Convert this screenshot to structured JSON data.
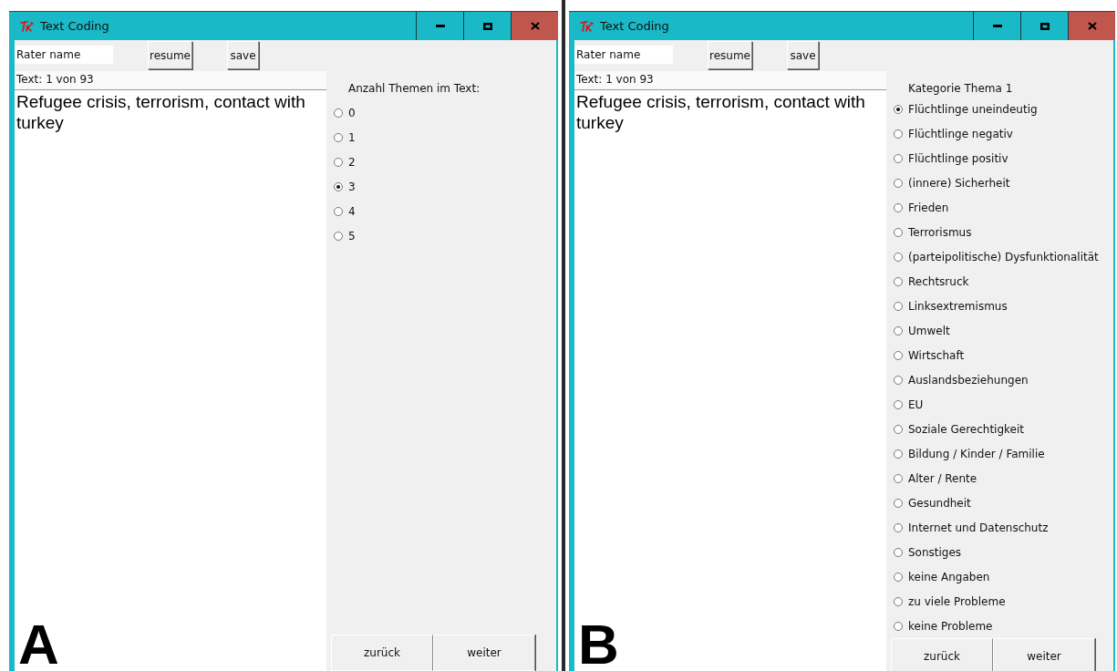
{
  "windows": [
    {
      "panel_label": "A",
      "title": "Text Coding",
      "rater_name": {
        "value": "Rater name"
      },
      "buttons": [
        "resume",
        "save"
      ],
      "text_counter": "Text: 1 von 93",
      "text_content": "Refugee crisis, terrorism, contact with turkey",
      "question": {
        "title": "Anzahl Themen im Text:",
        "options": [
          {
            "label": "0",
            "selected": false
          },
          {
            "label": "1",
            "selected": false
          },
          {
            "label": "2",
            "selected": false
          },
          {
            "label": "3",
            "selected": true
          },
          {
            "label": "4",
            "selected": false
          },
          {
            "label": "5",
            "selected": false
          }
        ]
      },
      "nav_buttons": [
        "zurück",
        "weiter"
      ]
    },
    {
      "panel_label": "B",
      "title": "Text Coding",
      "rater_name": {
        "value": "Rater name"
      },
      "buttons": [
        "resume",
        "save"
      ],
      "text_counter": "Text: 1 von 93",
      "text_content": "Refugee crisis, terrorism, contact with turkey",
      "question": {
        "title": "Kategorie Thema 1",
        "options": [
          {
            "label": "Flüchtlinge uneindeutig",
            "selected": true
          },
          {
            "label": "Flüchtlinge negativ",
            "selected": false
          },
          {
            "label": "Flüchtlinge positiv",
            "selected": false
          },
          {
            "label": "(innere) Sicherheit",
            "selected": false
          },
          {
            "label": "Frieden",
            "selected": false
          },
          {
            "label": "Terrorismus",
            "selected": false
          },
          {
            "label": "(parteipolitische) Dysfunktionalität",
            "selected": false
          },
          {
            "label": "Rechtsruck",
            "selected": false
          },
          {
            "label": "Linksextremismus",
            "selected": false
          },
          {
            "label": "Umwelt",
            "selected": false
          },
          {
            "label": "Wirtschaft",
            "selected": false
          },
          {
            "label": "Auslandsbeziehungen",
            "selected": false
          },
          {
            "label": "EU",
            "selected": false
          },
          {
            "label": "Soziale Gerechtigkeit",
            "selected": false
          },
          {
            "label": "Bildung / Kinder / Familie",
            "selected": false
          },
          {
            "label": "Alter / Rente",
            "selected": false
          },
          {
            "label": "Gesundheit",
            "selected": false
          },
          {
            "label": "Internet und Datenschutz",
            "selected": false
          },
          {
            "label": "Sonstiges",
            "selected": false
          },
          {
            "label": "keine Angaben",
            "selected": false
          },
          {
            "label": "zu viele Probleme",
            "selected": false
          },
          {
            "label": "keine Probleme",
            "selected": false
          }
        ]
      },
      "nav_buttons": [
        "zurück",
        "weiter"
      ]
    }
  ]
}
